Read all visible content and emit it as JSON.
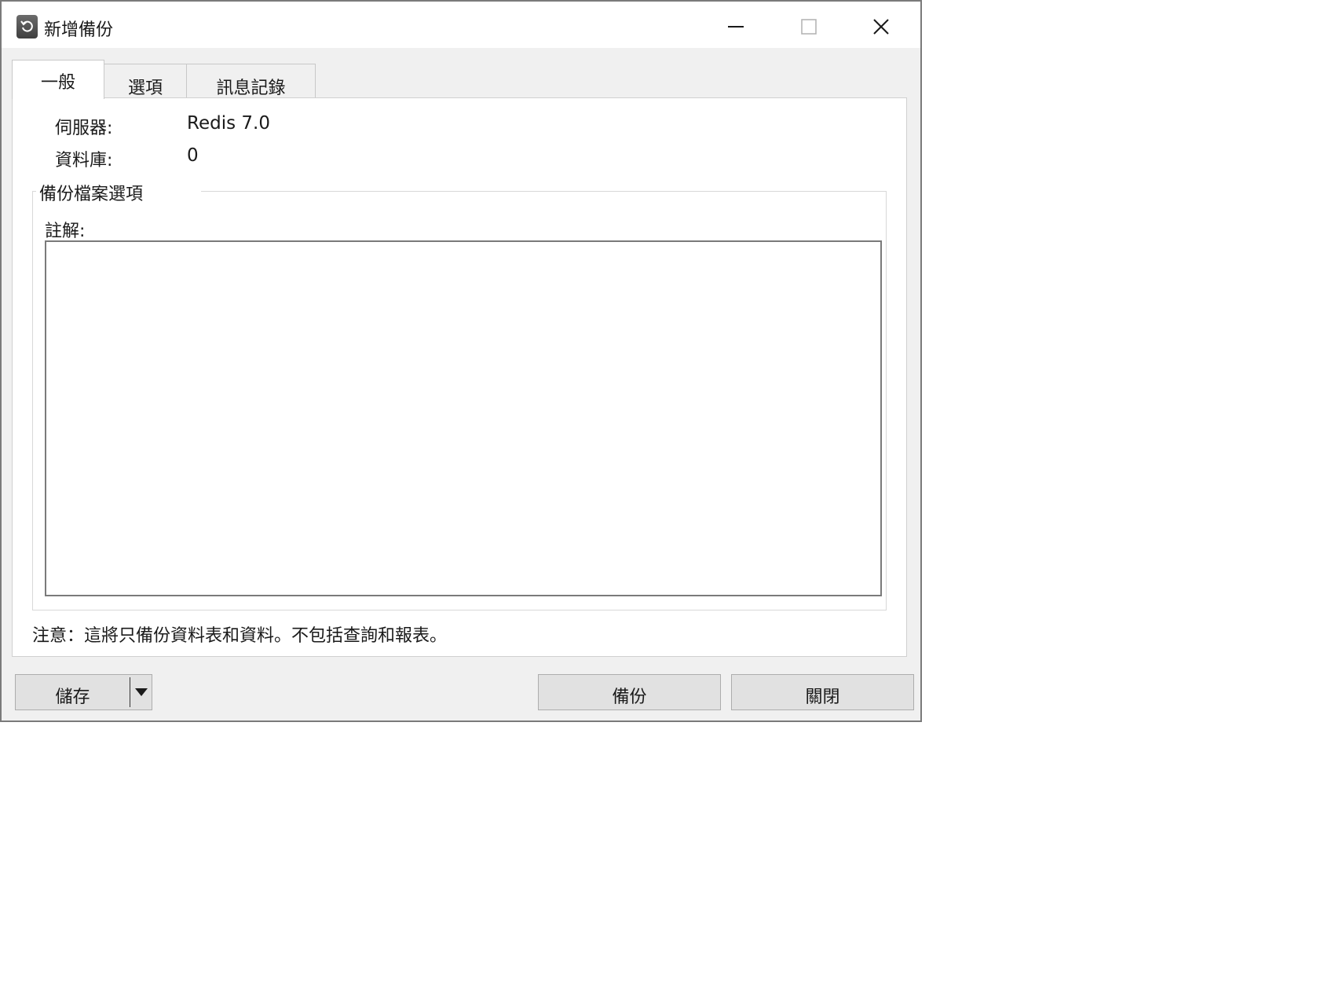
{
  "window": {
    "title": "新增備份",
    "icon": "backup-restore-icon"
  },
  "window_controls": {
    "minimize_icon": "minimize-icon",
    "maximize_icon": "maximize-icon",
    "close_icon": "close-icon"
  },
  "tabs": [
    {
      "label": "一般",
      "active": true
    },
    {
      "label": "選項",
      "active": false
    },
    {
      "label": "訊息記錄",
      "active": false
    }
  ],
  "general": {
    "server_label": "伺服器:",
    "server_value": "Redis 7.0",
    "database_label": "資料庫:",
    "database_value": "0",
    "group_title": "備份檔案選項",
    "comment_label": "註解:",
    "comment_value": "",
    "note": "注意：這將只備份資料表和資料。不包括查詢和報表。"
  },
  "footer": {
    "save_label": "儲存",
    "save_dropdown_icon": "caret-down-icon",
    "backup_label": "備份",
    "close_label": "關閉"
  },
  "colors": {
    "window_bg": "#f0f0f0",
    "panel_bg": "#ffffff",
    "button_bg": "#e1e1e1",
    "border": "#7a7a7a"
  }
}
